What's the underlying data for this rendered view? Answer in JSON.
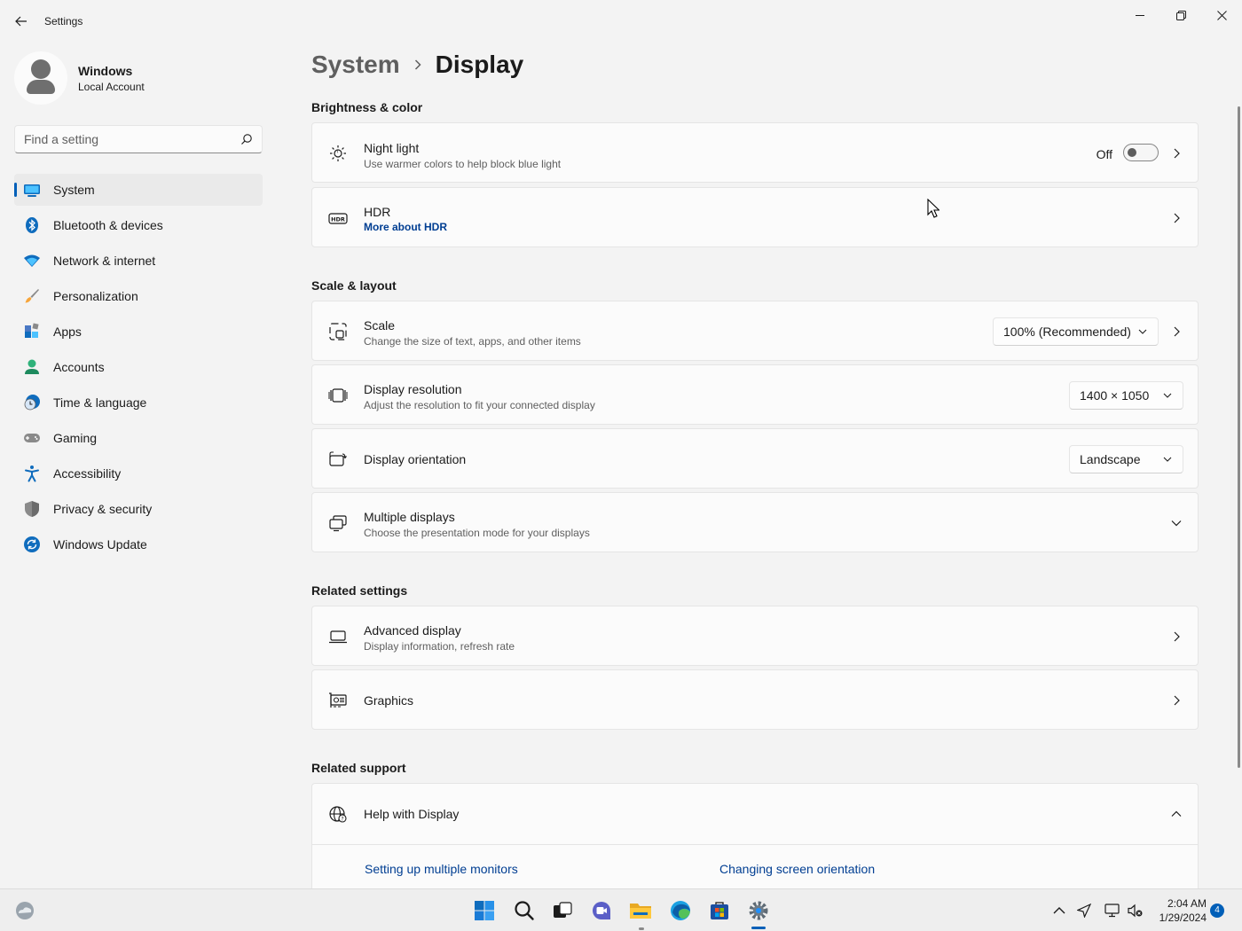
{
  "window": {
    "app_title": "Settings"
  },
  "profile": {
    "name": "Windows",
    "subtitle": "Local Account"
  },
  "search": {
    "placeholder": "Find a setting"
  },
  "sidebar": {
    "items": [
      {
        "label": "System",
        "icon": "system-icon",
        "active": true
      },
      {
        "label": "Bluetooth & devices",
        "icon": "bluetooth-icon"
      },
      {
        "label": "Network & internet",
        "icon": "wifi-icon"
      },
      {
        "label": "Personalization",
        "icon": "brush-icon"
      },
      {
        "label": "Apps",
        "icon": "apps-icon"
      },
      {
        "label": "Accounts",
        "icon": "accounts-icon"
      },
      {
        "label": "Time & language",
        "icon": "clock-globe-icon"
      },
      {
        "label": "Gaming",
        "icon": "gamepad-icon"
      },
      {
        "label": "Accessibility",
        "icon": "accessibility-icon"
      },
      {
        "label": "Privacy & security",
        "icon": "shield-icon"
      },
      {
        "label": "Windows Update",
        "icon": "update-icon"
      }
    ]
  },
  "breadcrumb": {
    "parent": "System",
    "current": "Display"
  },
  "sections": {
    "brightness": "Brightness & color",
    "scale": "Scale & layout",
    "related_settings": "Related settings",
    "related_support": "Related support"
  },
  "cards": {
    "night_light": {
      "title": "Night light",
      "subtitle": "Use warmer colors to help block blue light",
      "toggle_label": "Off",
      "toggle_on": false
    },
    "hdr": {
      "title": "HDR",
      "link": "More about HDR"
    },
    "scale": {
      "title": "Scale",
      "subtitle": "Change the size of text, apps, and other items",
      "value": "100% (Recommended)"
    },
    "resolution": {
      "title": "Display resolution",
      "subtitle": "Adjust the resolution to fit your connected display",
      "value": "1400 × 1050"
    },
    "orientation": {
      "title": "Display orientation",
      "value": "Landscape"
    },
    "multiple": {
      "title": "Multiple displays",
      "subtitle": "Choose the presentation mode for your displays"
    },
    "advanced": {
      "title": "Advanced display",
      "subtitle": "Display information, refresh rate"
    },
    "graphics": {
      "title": "Graphics"
    },
    "help": {
      "title": "Help with Display",
      "links": [
        "Setting up multiple monitors",
        "Changing screen orientation"
      ]
    }
  },
  "taskbar": {
    "time": "2:04 AM",
    "date": "1/29/2024",
    "notifications": "4"
  },
  "colors": {
    "accent": "#005fb8",
    "link": "#003e92",
    "background": "#f3f3f3",
    "card": "#fbfbfb"
  }
}
